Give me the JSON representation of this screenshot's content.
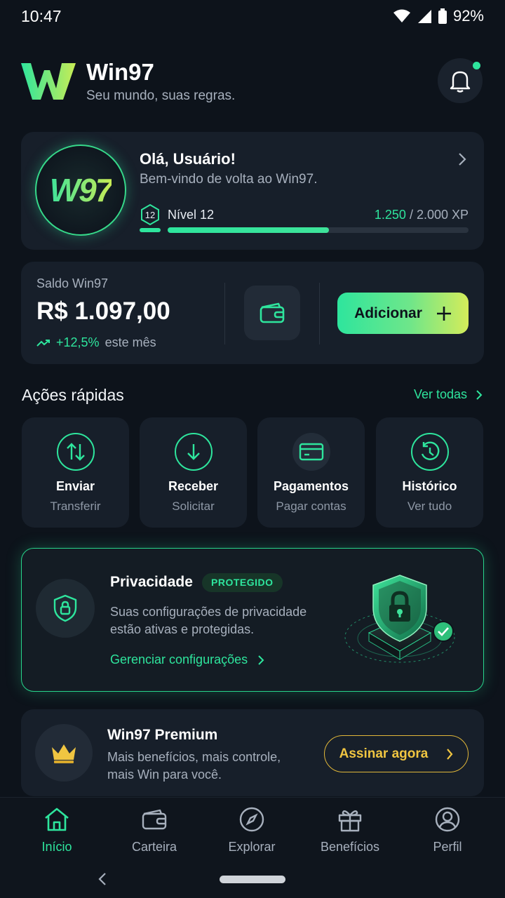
{
  "status_bar": {
    "time": "10:47",
    "battery": "92%"
  },
  "header": {
    "title": "Win97",
    "subtitle": "Seu mundo, suas regras."
  },
  "profile": {
    "avatar_text": "W97",
    "greeting": "Olá, Usuário!",
    "welcome": "Bem-vindo de volta ao Win97.",
    "level_number": "12",
    "level_label": "Nível 12",
    "xp_current": "1.250",
    "xp_total": "/ 2.000 XP",
    "xp_progress": 0.535
  },
  "balance": {
    "label": "Saldo Win97",
    "value": "R$ 1.097,00",
    "trend_pct": "+12,5%",
    "trend_suffix": "este mês",
    "add_label": "Adicionar"
  },
  "quick_actions": {
    "title": "Ações rápidas",
    "see_all": "Ver todas",
    "items": [
      {
        "title": "Enviar",
        "sub": "Transferir",
        "icon": "transfer-icon"
      },
      {
        "title": "Receber",
        "sub": "Solicitar",
        "icon": "download-icon"
      },
      {
        "title": "Pagamentos",
        "sub": "Pagar contas",
        "icon": "card-icon"
      },
      {
        "title": "Histórico",
        "sub": "Ver tudo",
        "icon": "history-icon"
      }
    ]
  },
  "privacy": {
    "title": "Privacidade",
    "badge": "PROTEGIDO",
    "desc": "Suas configurações de privacidade estão ativas e protegidas.",
    "link": "Gerenciar configurações"
  },
  "premium": {
    "title": "Win97 Premium",
    "desc": "Mais benefícios, mais controle, mais Win para você.",
    "button": "Assinar agora"
  },
  "nav": {
    "items": [
      {
        "label": "Início",
        "icon": "home-icon",
        "active": true
      },
      {
        "label": "Carteira",
        "icon": "wallet-icon",
        "active": false
      },
      {
        "label": "Explorar",
        "icon": "compass-icon",
        "active": false
      },
      {
        "label": "Benefícios",
        "icon": "gift-icon",
        "active": false
      },
      {
        "label": "Perfil",
        "icon": "user-icon",
        "active": false
      }
    ]
  },
  "colors": {
    "accent": "#2ee59d",
    "gold": "#f0c541",
    "background": "#0d131b",
    "card": "#171f2a"
  }
}
